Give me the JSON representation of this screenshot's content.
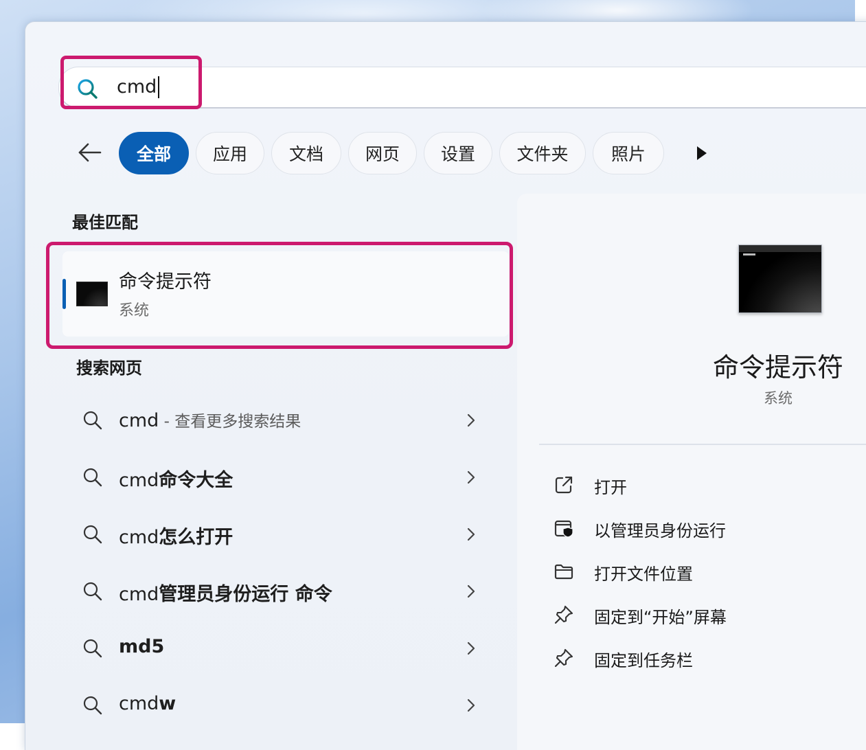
{
  "search": {
    "query": "cmd"
  },
  "filters": {
    "items": [
      "全部",
      "应用",
      "文档",
      "网页",
      "设置",
      "文件夹",
      "照片"
    ],
    "active_index": 0
  },
  "best_match": {
    "section_title": "最佳匹配",
    "title": "命令提示符",
    "subtitle": "系统"
  },
  "web_search": {
    "section_title": "搜索网页",
    "items": [
      {
        "prefix": "cmd",
        "bold": "",
        "suffix": " - 查看更多搜索结果"
      },
      {
        "prefix": "cmd",
        "bold": "命令大全",
        "suffix": ""
      },
      {
        "prefix": "cmd",
        "bold": "怎么打开",
        "suffix": ""
      },
      {
        "prefix": "cmd",
        "bold": "管理员身份运行 命令",
        "suffix": ""
      },
      {
        "prefix": "",
        "bold": "md5",
        "suffix": ""
      },
      {
        "prefix": "cmd",
        "bold": "w",
        "suffix": ""
      }
    ]
  },
  "preview": {
    "title": "命令提示符",
    "subtitle": "系统",
    "actions": [
      {
        "label": "打开",
        "icon": "open-external-icon"
      },
      {
        "label": "以管理员身份运行",
        "icon": "run-as-admin-icon"
      },
      {
        "label": "打开文件位置",
        "icon": "folder-icon"
      },
      {
        "label": "固定到“开始”屏幕",
        "icon": "pin-icon"
      },
      {
        "label": "固定到任务栏",
        "icon": "pin-icon"
      }
    ]
  },
  "colors": {
    "accent": "#0a5fb4",
    "highlight": "#cc1a6e"
  }
}
